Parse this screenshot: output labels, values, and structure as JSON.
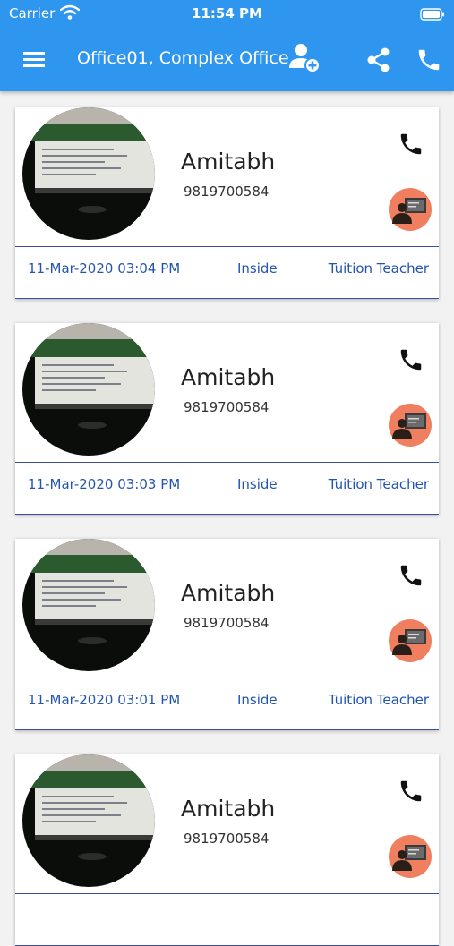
{
  "status_bar": {
    "carrier": "Carrier",
    "time": "11:54 PM"
  },
  "app_bar": {
    "title": "Office01, Complex Office",
    "icons": [
      "menu-icon",
      "add-user-icon",
      "share-icon",
      "phone-icon"
    ]
  },
  "colors": {
    "app_bar": "#2f96ef",
    "badge": "#ef7f5f",
    "meta_text": "#2354b0",
    "divider": "#3b4fa8"
  },
  "entries": [
    {
      "name": "Amitabh",
      "phone": "9819700584",
      "time": "11-Mar-2020 03:04 PM",
      "status": "Inside",
      "role": "Tuition Teacher"
    },
    {
      "name": "Amitabh",
      "phone": "9819700584",
      "time": "11-Mar-2020 03:03 PM",
      "status": "Inside",
      "role": "Tuition Teacher"
    },
    {
      "name": "Amitabh",
      "phone": "9819700584",
      "time": "11-Mar-2020 03:01 PM",
      "status": "Inside",
      "role": "Tuition Teacher"
    },
    {
      "name": "Amitabh",
      "phone": "9819700584",
      "time": "",
      "status": "",
      "role": ""
    }
  ]
}
